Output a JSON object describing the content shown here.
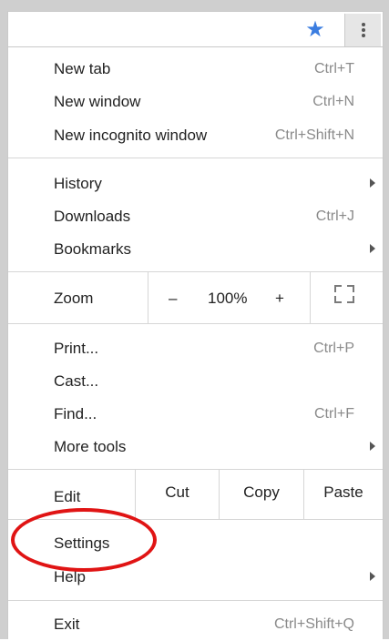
{
  "toolbar": {
    "star_icon": "star-icon",
    "menu_icon": "kebab-menu-icon",
    "star_color": "#3b7de0"
  },
  "menu": {
    "new_tab": {
      "label": "New tab",
      "shortcut": "Ctrl+T"
    },
    "new_window": {
      "label": "New window",
      "shortcut": "Ctrl+N"
    },
    "new_incognito": {
      "label": "New incognito window",
      "shortcut": "Ctrl+Shift+N"
    },
    "history": {
      "label": "History"
    },
    "downloads": {
      "label": "Downloads",
      "shortcut": "Ctrl+J"
    },
    "bookmarks": {
      "label": "Bookmarks"
    },
    "zoom": {
      "label": "Zoom",
      "minus": "–",
      "level": "100%",
      "plus": "+"
    },
    "print": {
      "label": "Print...",
      "shortcut": "Ctrl+P"
    },
    "cast": {
      "label": "Cast..."
    },
    "find": {
      "label": "Find...",
      "shortcut": "Ctrl+F"
    },
    "more_tools": {
      "label": "More tools"
    },
    "edit": {
      "label": "Edit",
      "cut": "Cut",
      "copy": "Copy",
      "paste": "Paste"
    },
    "settings": {
      "label": "Settings"
    },
    "help": {
      "label": "Help"
    },
    "exit": {
      "label": "Exit",
      "shortcut": "Ctrl+Shift+Q"
    }
  },
  "annotation": {
    "highlight_color": "#e01414"
  }
}
